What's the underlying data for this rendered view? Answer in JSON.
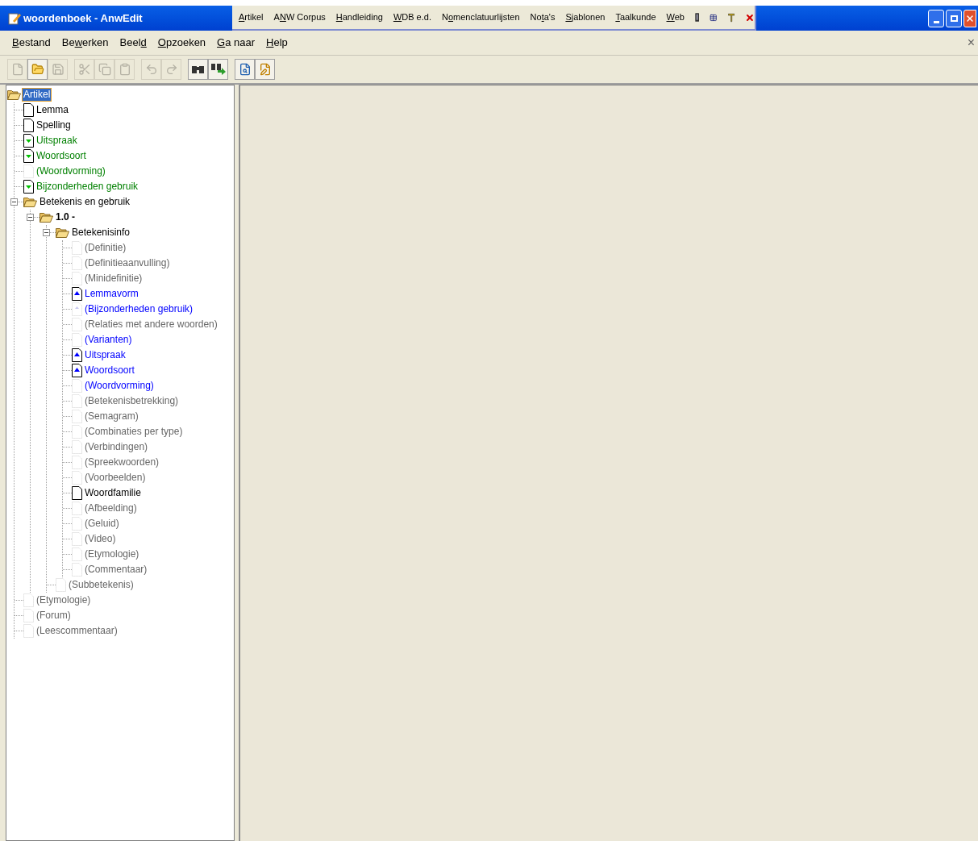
{
  "window": {
    "title": "woordenboek - AnwEdit"
  },
  "title_menu": [
    {
      "key": "A",
      "after": "rtikel"
    },
    {
      "before": "A",
      "key": "N",
      "after": "W Corpus"
    },
    {
      "key": "H",
      "after": "andleiding"
    },
    {
      "key": "W",
      "after": "DB e.d."
    },
    {
      "before": "N",
      "key": "o",
      "after": "menclatuurlijsten"
    },
    {
      "before": "No",
      "key": "t",
      "after": "a's"
    },
    {
      "key": "S",
      "after": "jablonen"
    },
    {
      "key": "T",
      "after": "aalkunde"
    },
    {
      "key": "W",
      "after": "eb"
    }
  ],
  "title_tools": [
    {
      "kind": "device"
    },
    {
      "kind": "table"
    },
    {
      "kind": "pin"
    },
    {
      "kind": "close"
    }
  ],
  "menu_bar": [
    {
      "key": "B",
      "after": "estand"
    },
    {
      "before": "Be",
      "key": "w",
      "after": "erken"
    },
    {
      "before": "Beel",
      "key": "d"
    },
    {
      "key": "O",
      "after": "pzoeken"
    },
    {
      "key": "G",
      "after": "a naar"
    },
    {
      "key": "H",
      "after": "elp"
    }
  ],
  "menu_close": "×",
  "toolbar": [
    {
      "buttons": [
        {
          "kind": "new",
          "disabled": true
        },
        {
          "kind": "open",
          "disabled": false
        },
        {
          "kind": "save",
          "disabled": true
        }
      ]
    },
    {
      "buttons": [
        {
          "kind": "cut",
          "disabled": true
        },
        {
          "kind": "copy",
          "disabled": true
        },
        {
          "kind": "paste",
          "disabled": true
        }
      ]
    },
    {
      "buttons": [
        {
          "kind": "undo",
          "disabled": true
        },
        {
          "kind": "redo",
          "disabled": true
        }
      ]
    },
    {
      "buttons": [
        {
          "kind": "find",
          "disabled": false
        },
        {
          "kind": "find-next",
          "disabled": false
        }
      ]
    },
    {
      "buttons": [
        {
          "kind": "preview",
          "disabled": false
        },
        {
          "kind": "edit",
          "disabled": false
        }
      ]
    }
  ],
  "tree": [
    {
      "label": "Artikel",
      "kind": "folder",
      "bold": false,
      "selected": true,
      "children": [
        {
          "label": "Lemma",
          "kind": "doc",
          "color": "#000000",
          "bold": false,
          "selected": false
        },
        {
          "label": "Spelling",
          "kind": "doc",
          "color": "#000000",
          "bold": false,
          "selected": false
        },
        {
          "label": "Uitspraak",
          "kind": "doc-down",
          "color": "#008000",
          "bold": false,
          "selected": false
        },
        {
          "label": "Woordsoort",
          "kind": "doc-down",
          "color": "#008000",
          "bold": false,
          "selected": false
        },
        {
          "label": "(Woordvorming)",
          "kind": "empty",
          "color": "#008000",
          "bold": false,
          "selected": false
        },
        {
          "label": "Bijzonderheden gebruik",
          "kind": "doc-down",
          "color": "#008000",
          "bold": false,
          "selected": false
        },
        {
          "label": "Betekenis en gebruik",
          "kind": "folder",
          "color": "#000000",
          "bold": false,
          "selected": false,
          "expanded": true,
          "children": [
            {
              "label": "1.0 -",
              "kind": "folder",
              "color": "#000000",
              "bold": true,
              "selected": false,
              "expanded": true,
              "children": [
                {
                  "label": "Betekenisinfo",
                  "kind": "folder",
                  "color": "#000000",
                  "bold": false,
                  "selected": false,
                  "expanded": true,
                  "children": [
                    {
                      "label": "(Definitie)",
                      "kind": "empty",
                      "color": "#666666",
                      "bold": false,
                      "selected": false
                    },
                    {
                      "label": "(Definitieaanvulling)",
                      "kind": "empty",
                      "color": "#666666",
                      "bold": false,
                      "selected": false
                    },
                    {
                      "label": "(Minidefinitie)",
                      "kind": "empty",
                      "color": "#666666",
                      "bold": false,
                      "selected": false
                    },
                    {
                      "label": "Lemmavorm",
                      "kind": "doc-up",
                      "color": "#0000ff",
                      "bold": false,
                      "selected": false
                    },
                    {
                      "label": "(Bijzonderheden gebruik)",
                      "kind": "empty-up",
                      "color": "#0000ff",
                      "bold": false,
                      "selected": false
                    },
                    {
                      "label": "(Relaties met andere woorden)",
                      "kind": "empty",
                      "color": "#666666",
                      "bold": false,
                      "selected": false
                    },
                    {
                      "label": "(Varianten)",
                      "kind": "empty",
                      "color": "#0000ff",
                      "bold": false,
                      "selected": false
                    },
                    {
                      "label": "Uitspraak",
                      "kind": "doc-up",
                      "color": "#0000ff",
                      "bold": false,
                      "selected": false
                    },
                    {
                      "label": "Woordsoort",
                      "kind": "doc-up",
                      "color": "#0000ff",
                      "bold": false,
                      "selected": false
                    },
                    {
                      "label": "(Woordvorming)",
                      "kind": "empty",
                      "color": "#0000ff",
                      "bold": false,
                      "selected": false
                    },
                    {
                      "label": "(Betekenisbetrekking)",
                      "kind": "empty",
                      "color": "#666666",
                      "bold": false,
                      "selected": false
                    },
                    {
                      "label": "(Semagram)",
                      "kind": "empty",
                      "color": "#666666",
                      "bold": false,
                      "selected": false
                    },
                    {
                      "label": "(Combinaties per type)",
                      "kind": "empty",
                      "color": "#666666",
                      "bold": false,
                      "selected": false
                    },
                    {
                      "label": "(Verbindingen)",
                      "kind": "empty",
                      "color": "#666666",
                      "bold": false,
                      "selected": false
                    },
                    {
                      "label": "(Spreekwoorden)",
                      "kind": "empty",
                      "color": "#666666",
                      "bold": false,
                      "selected": false
                    },
                    {
                      "label": "(Voorbeelden)",
                      "kind": "empty",
                      "color": "#666666",
                      "bold": false,
                      "selected": false
                    },
                    {
                      "label": "Woordfamilie",
                      "kind": "doc",
                      "color": "#000000",
                      "bold": false,
                      "selected": false
                    },
                    {
                      "label": "(Afbeelding)",
                      "kind": "empty",
                      "color": "#666666",
                      "bold": false,
                      "selected": false
                    },
                    {
                      "label": "(Geluid)",
                      "kind": "empty",
                      "color": "#666666",
                      "bold": false,
                      "selected": false
                    },
                    {
                      "label": "(Video)",
                      "kind": "empty",
                      "color": "#666666",
                      "bold": false,
                      "selected": false
                    },
                    {
                      "label": "(Etymologie)",
                      "kind": "empty",
                      "color": "#666666",
                      "bold": false,
                      "selected": false
                    },
                    {
                      "label": "(Commentaar)",
                      "kind": "empty",
                      "color": "#666666",
                      "bold": false,
                      "selected": false
                    }
                  ]
                },
                {
                  "label": "(Subbetekenis)",
                  "kind": "empty",
                  "color": "#666666",
                  "bold": false,
                  "selected": false
                }
              ]
            }
          ]
        },
        {
          "label": "(Etymologie)",
          "kind": "empty",
          "color": "#666666",
          "bold": false,
          "selected": false
        },
        {
          "label": "(Forum)",
          "kind": "empty",
          "color": "#666666",
          "bold": false,
          "selected": false
        },
        {
          "label": "(Leescommentaar)",
          "kind": "empty",
          "color": "#666666",
          "bold": false,
          "selected": false
        }
      ]
    }
  ]
}
